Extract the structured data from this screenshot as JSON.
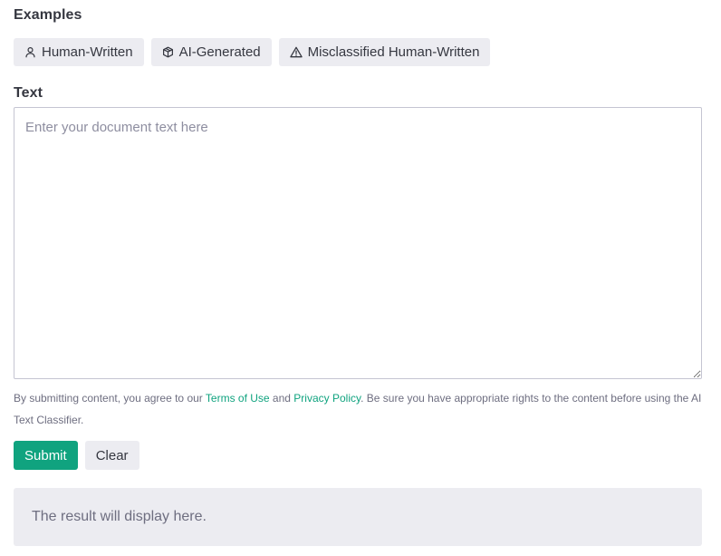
{
  "examples": {
    "label": "Examples",
    "chips": [
      {
        "label": "Human-Written",
        "icon": "person-icon"
      },
      {
        "label": "AI-Generated",
        "icon": "cube-icon"
      },
      {
        "label": "Misclassified Human-Written",
        "icon": "warning-icon"
      }
    ]
  },
  "text": {
    "label": "Text",
    "placeholder": "Enter your document text here",
    "value": ""
  },
  "disclaimer": {
    "before": "By submitting content, you agree to our ",
    "terms_link": "Terms of Use",
    "and": " and ",
    "privacy_link": "Privacy Policy",
    "after": ". Be sure you have appropriate rights to the content before using the AI Text Classifier."
  },
  "actions": {
    "submit_label": "Submit",
    "clear_label": "Clear"
  },
  "result": {
    "text": "The result will display here."
  },
  "colors": {
    "accent": "#10a37f",
    "chip_bg": "#ececf1",
    "text": "#353740",
    "muted": "#6e6e80",
    "border": "#c5c5d2"
  }
}
